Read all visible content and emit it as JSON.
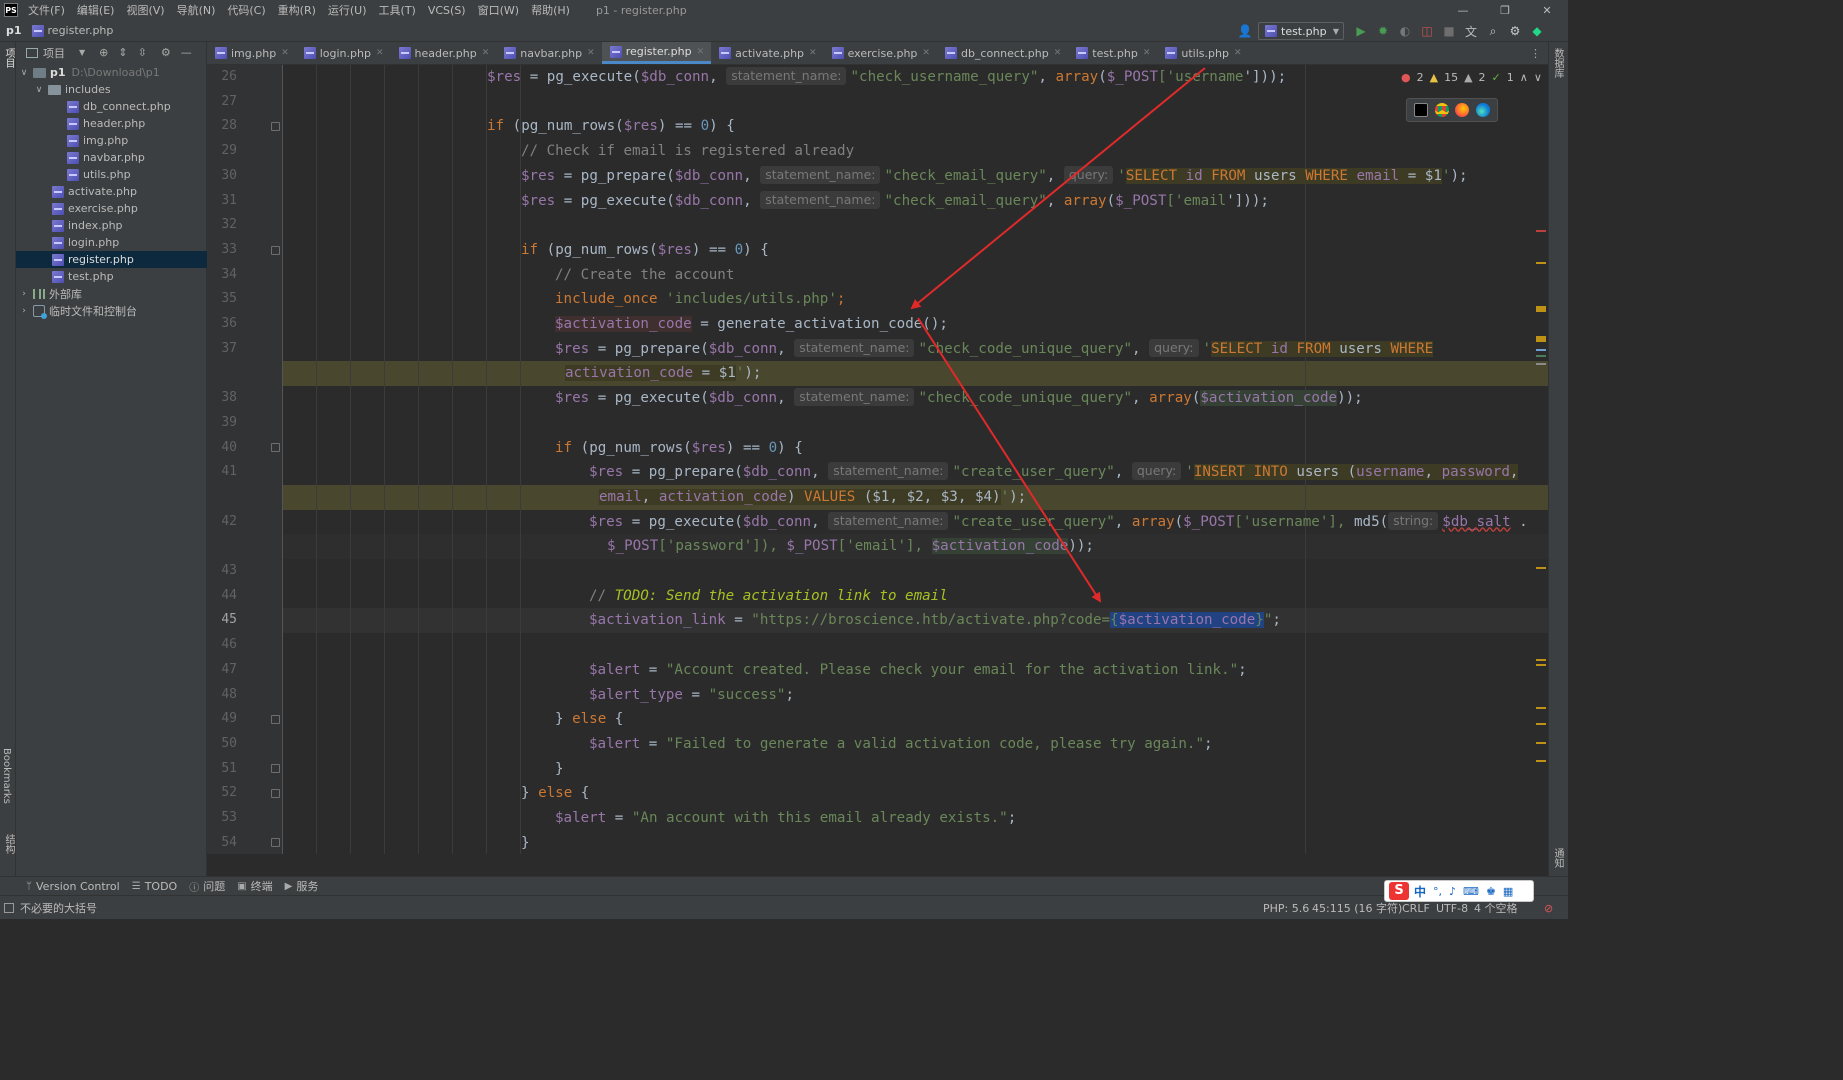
{
  "menubar": {
    "items": [
      "文件(F)",
      "编辑(E)",
      "视图(V)",
      "导航(N)",
      "代码(C)",
      "重构(R)",
      "运行(U)",
      "工具(T)",
      "VCS(S)",
      "窗口(W)",
      "帮助(H)"
    ],
    "window_title": "p1 - register.php"
  },
  "navbar": {
    "project": "p1",
    "file": "register.php",
    "run_config": "test.php"
  },
  "project_panel": {
    "title": "项目",
    "items": [
      {
        "label": "p1",
        "path": "D:\\Download\\p1"
      },
      {
        "label": "includes"
      },
      {
        "label": "db_connect.php"
      },
      {
        "label": "header.php"
      },
      {
        "label": "img.php"
      },
      {
        "label": "navbar.php"
      },
      {
        "label": "utils.php"
      },
      {
        "label": "activate.php"
      },
      {
        "label": "exercise.php"
      },
      {
        "label": "index.php"
      },
      {
        "label": "login.php"
      },
      {
        "label": "register.php"
      },
      {
        "label": "test.php"
      },
      {
        "label": "外部库"
      },
      {
        "label": "临时文件和控制台"
      }
    ]
  },
  "tabs": [
    "img.php",
    "login.php",
    "header.php",
    "navbar.php",
    "register.php",
    "activate.php",
    "exercise.php",
    "db_connect.php",
    "test.php",
    "utils.php"
  ],
  "active_tab": "register.php",
  "line_numbers": [
    "26",
    "27",
    "28",
    "29",
    "30",
    "31",
    "32",
    "33",
    "34",
    "35",
    "36",
    "37",
    "38",
    "39",
    "40",
    "41",
    "42",
    "43",
    "44",
    "45",
    "46",
    "47",
    "48",
    "49",
    "50",
    "51",
    "52",
    "53",
    "54"
  ],
  "hints": {
    "statement_name": "statement_name:",
    "query": "query:",
    "string": "string:"
  },
  "code": {
    "l26": {
      "a": "$res",
      "b": " = ",
      "c": "pg_execute",
      "d": "(",
      "e": "$db_conn",
      "f": ", ",
      "g": "\"check_username_query\"",
      "h": ", ",
      "i": "array",
      "j": "(",
      "k": "$_POST",
      "l": "['",
      "m": "username",
      "n": "']));"
    },
    "l28": {
      "a": "if",
      "b": " (",
      "c": "pg_num_rows",
      "d": "(",
      "e": "$res",
      "f": ") == ",
      "g": "0",
      "h": ") {"
    },
    "l29": "// Check if email is registered already",
    "l30": {
      "a": "$res",
      "b": " = ",
      "c": "pg_prepare",
      "d": "(",
      "e": "$db_conn",
      "f": ", ",
      "g": "\"check_email_query\"",
      "h": ", ",
      "i": "'",
      "j": "SELECT",
      "k": " id ",
      "l": "FROM",
      "m": " users ",
      "n": "WHERE",
      "o": " email",
      "p": " = $1",
      "q": "'",
      "r": ");"
    },
    "l31": {
      "a": "$res",
      "b": " = ",
      "c": "pg_execute",
      "d": "(",
      "e": "$db_conn",
      "f": ", ",
      "g": "\"check_email_query\"",
      "h": ", ",
      "i": "array",
      "j": "(",
      "k": "$_POST",
      "l": "['",
      "m": "email",
      "n": "']));"
    },
    "l33": {
      "a": "if",
      "b": " (",
      "c": "pg_num_rows",
      "d": "(",
      "e": "$res",
      "f": ") == ",
      "g": "0",
      "h": ") {"
    },
    "l34": "// Create the account",
    "l35": {
      "a": "include_once",
      "b": " ",
      "c": "'includes/utils.php'",
      "d": ";"
    },
    "l36": {
      "a": "$activation_code",
      "b": " = ",
      "c": "generate_activation_code",
      "d": "();"
    },
    "l37": {
      "a": "$res",
      "b": " = ",
      "c": "pg_prepare",
      "d": "(",
      "e": "$db_conn",
      "f": ", ",
      "g": "\"check_code_unique_query\"",
      "h": ", ",
      "i": "'",
      "j": "SELECT",
      "k": " id ",
      "l": "FROM",
      "m": " users ",
      "n": "WHERE"
    },
    "l37b": {
      "a": "activation_code",
      "b": " = $1",
      "c": "'",
      "d": ");"
    },
    "l38": {
      "a": "$res",
      "b": " = ",
      "c": "pg_execute",
      "d": "(",
      "e": "$db_conn",
      "f": ", ",
      "g": "\"check_code_unique_query\"",
      "h": ", ",
      "i": "array",
      "j": "(",
      "k": "$activation_code",
      "l": "));"
    },
    "l40": {
      "a": "if",
      "b": " (",
      "c": "pg_num_rows",
      "d": "(",
      "e": "$res",
      "f": ") == ",
      "g": "0",
      "h": ") {"
    },
    "l41": {
      "a": "$res",
      "b": " = ",
      "c": "pg_prepare",
      "d": "(",
      "e": "$db_conn",
      "f": ", ",
      "g": "\"create_user_query\"",
      "h": ", ",
      "i": "'",
      "j": "INSERT INTO",
      "k": " users ",
      "l": "(",
      "m": "username",
      "n": ", ",
      "o": "password",
      "p": ","
    },
    "l41b": {
      "a": "email",
      "b": ", ",
      "c": "activation_code",
      "d": ") ",
      "e": "VALUES",
      "f": " (",
      "g": "$1",
      "h": ", ",
      "i": "$2",
      "j": ", ",
      "k": "$3",
      "l": ", ",
      "m": "$4",
      "n": ")",
      "o": "'",
      "p": ");"
    },
    "l42": {
      "a": "$res",
      "b": " = ",
      "c": "pg_execute",
      "d": "(",
      "e": "$db_conn",
      "f": ", ",
      "g": "\"create_user_query\"",
      "h": ", ",
      "i": "array",
      "j": "(",
      "k": "$_POST",
      "l": "['",
      "m": "username",
      "n": "'], ",
      "o": "md5",
      "p": "(",
      "q": "$db_salt",
      "r": " ."
    },
    "l42b": {
      "a": "$_POST",
      "b": "['",
      "c": "password",
      "d": "']), ",
      "e": "$_POST",
      "f": "['",
      "g": "email",
      "h": "'], ",
      "i": "$activation_code",
      "j": "));"
    },
    "l44": {
      "a": "// ",
      "b": "TODO: Send the activation link to email"
    },
    "l45": {
      "a": "$activation_link",
      "b": " = ",
      "c": "\"https://broscience.htb/activate.php?code=",
      "d": "{",
      "e": "$activation_code",
      "f": "}",
      "g": "\"",
      "h": ";"
    },
    "l47": {
      "a": "$alert",
      "b": " = ",
      "c": "\"Account created. Please check your email for the activation link.\"",
      "d": ";"
    },
    "l48": {
      "a": "$alert_type",
      "b": " = ",
      "c": "\"success\"",
      "d": ";"
    },
    "l49": {
      "a": "} ",
      "b": "else",
      "c": " {"
    },
    "l50": {
      "a": "$alert",
      "b": " = ",
      "c": "\"Failed to generate a valid activation code, please try again.\"",
      "d": ";"
    },
    "l51": "}",
    "l52": {
      "a": "} ",
      "b": "else",
      "c": " {"
    },
    "l53": {
      "a": "$alert",
      "b": " = ",
      "c": "\"An account with this email already exists.\"",
      "d": ";"
    },
    "l54": "}"
  },
  "inspections": {
    "errors": "2",
    "warnings": "15",
    "weak_warnings": "2",
    "typos": "1"
  },
  "side_labels": {
    "left_top": "项目",
    "bookmarks": "Bookmarks",
    "structure": "结构",
    "right_top": "数据库",
    "notifications": "通知"
  },
  "tool_windows": [
    "Version Control",
    "TODO",
    "问题",
    "终端",
    "服务"
  ],
  "status": {
    "message": "不必要的大括号",
    "php": "PHP: 5.6",
    "position": "45:115 (16 字符)",
    "line_sep": "CRLF",
    "encoding": "UTF-8",
    "indent": "4 个空格"
  },
  "ime": {
    "logo": "S",
    "lang": "中"
  },
  "colors": {
    "accent": "#4a88c7",
    "keyword": "#cc7832",
    "string": "#6a8759",
    "variable": "#9876aa",
    "function": "#ffc66d",
    "annotation_arrow": "#e02a2a"
  }
}
